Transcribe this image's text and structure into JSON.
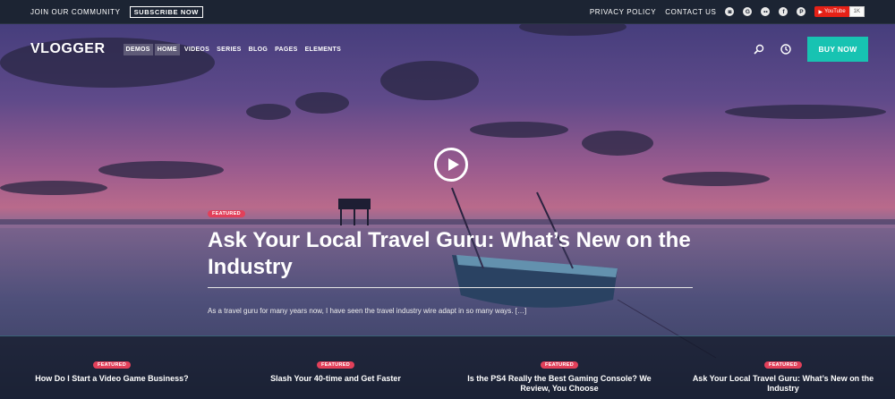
{
  "topbar": {
    "community": "JOIN OUR COMMUNITY",
    "subscribe": "SUBSCRIBE NOW",
    "privacy": "PRIVACY POLICY",
    "contact": "CONTACT US",
    "youtube_label": "YouTube",
    "youtube_count": "1K"
  },
  "nav": {
    "logo": "VLOGGER",
    "items": [
      "DEMOS",
      "HOME",
      "VIDEOS",
      "SERIES",
      "BLOG",
      "PAGES",
      "ELEMENTS"
    ],
    "buy": "BUY NOW"
  },
  "hero": {
    "badge": "FEATURED",
    "title": "Ask Your Local Travel Guru: What’s New on the Industry",
    "excerpt": "As a travel guru for many years now, I have seen the travel industry wire adapt in so many ways. […]"
  },
  "featured_posts": [
    {
      "badge": "FEATURED",
      "title": "How Do I Start a Video Game Business?"
    },
    {
      "badge": "FEATURED",
      "title": "Slash Your 40-time and Get Faster"
    },
    {
      "badge": "FEATURED",
      "title": "Is the PS4 Really the Best Gaming Console? We Review, You Choose"
    },
    {
      "badge": "FEATURED",
      "title": "Ask Your Local Travel Guru: What’s New on the Industry"
    }
  ],
  "colors": {
    "accent": "#17c3b2",
    "badge": "#e2405a",
    "topbar": "#1c2433"
  }
}
